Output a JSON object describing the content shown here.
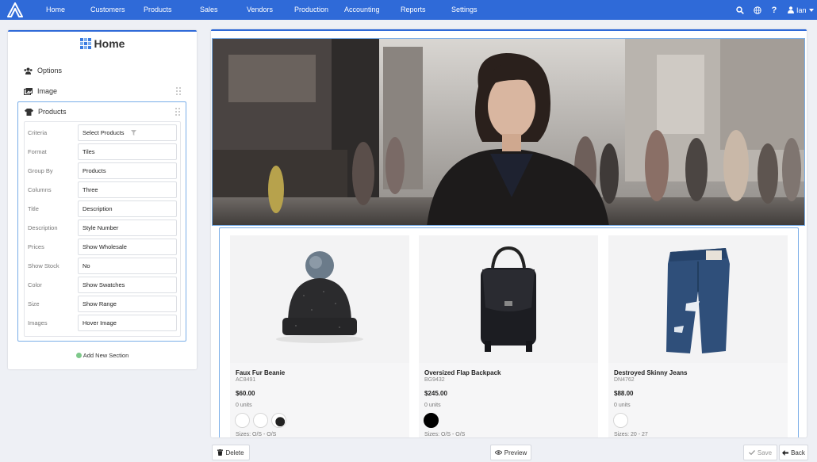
{
  "nav": {
    "items": [
      "Home",
      "Customers",
      "Products",
      "Sales",
      "Vendors",
      "Production",
      "Accounting",
      "Reports",
      "Settings"
    ],
    "user": "Ian"
  },
  "sidebar": {
    "title": "Home",
    "sections": [
      {
        "label": "Options",
        "icon": "users-icon"
      },
      {
        "label": "Image",
        "icon": "image-icon"
      },
      {
        "label": "Products",
        "icon": "shirt-icon"
      }
    ],
    "fields": [
      {
        "label": "Criteria",
        "value": "Select Products"
      },
      {
        "label": "Format",
        "value": "Tiles"
      },
      {
        "label": "Group By",
        "value": "Products"
      },
      {
        "label": "Columns",
        "value": "Three"
      },
      {
        "label": "Title",
        "value": "Description"
      },
      {
        "label": "Description",
        "value": "Style Number"
      },
      {
        "label": "Prices",
        "value": "Show Wholesale"
      },
      {
        "label": "Show Stock",
        "value": "No"
      },
      {
        "label": "Color",
        "value": "Show Swatches"
      },
      {
        "label": "Size",
        "value": "Show Range"
      },
      {
        "label": "Images",
        "value": "Hover Image"
      }
    ],
    "add_section": "Add New Section"
  },
  "products": [
    {
      "name": "Faux Fur Beanie",
      "sku": "AC8491",
      "price": "$60.00",
      "units": "0 units",
      "sizes": "Sizes: O/S - O/S"
    },
    {
      "name": "Oversized Flap Backpack",
      "sku": "BG9432",
      "price": "$245.00",
      "units": "0 units",
      "sizes": "Sizes: O/S - O/S"
    },
    {
      "name": "Destroyed Skinny Jeans",
      "sku": "DN4762",
      "price": "$88.00",
      "units": "0 units",
      "sizes": "Sizes: 20 - 27"
    }
  ],
  "buttons": {
    "delete": "Delete",
    "preview": "Preview",
    "save": "Save",
    "back": "Back"
  },
  "colors": {
    "brand": "#2f6ad8",
    "accent_border": "#7aaee8"
  }
}
